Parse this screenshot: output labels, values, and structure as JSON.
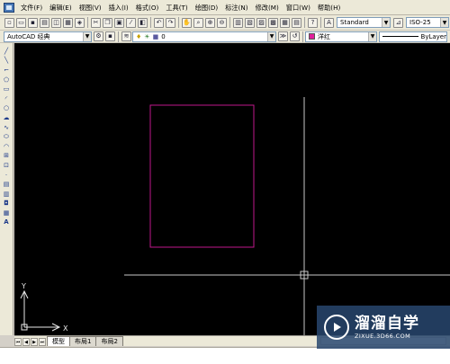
{
  "menubar": {
    "items": [
      "文件(F)",
      "编辑(E)",
      "视图(V)",
      "插入(I)",
      "格式(O)",
      "工具(T)",
      "绘图(D)",
      "标注(N)",
      "修改(M)",
      "窗口(W)",
      "帮助(H)"
    ]
  },
  "toolbar1": {
    "text_style": "Standard",
    "dim_style": "ISO-25"
  },
  "toolbar2": {
    "workspace": "AutoCAD 经典",
    "layer": "0",
    "color": "洋红",
    "linetype": "ByLayer"
  },
  "canvas": {
    "ucs_x_label": "X",
    "ucs_y_label": "Y",
    "rectangle_color": "#c0188c",
    "crosshair_color": "#c8c8c8"
  },
  "tabs": [
    "模型",
    "布局1",
    "布局2"
  ],
  "watermark": {
    "title": "溜溜自学",
    "url": "ZIXUE.3D66.COM"
  }
}
